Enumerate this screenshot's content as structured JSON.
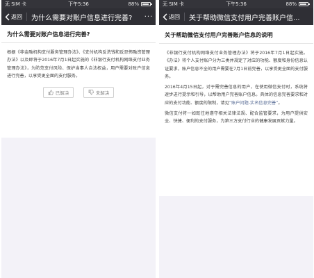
{
  "left": {
    "status": {
      "carrier": "无 SIM 卡",
      "time": "下午5:36",
      "battery": "88%",
      "battery_fraction": 0.88
    },
    "nav": {
      "back_label": "返回",
      "title": "为什么需要对账户信息进行完善?",
      "more": "···"
    },
    "title": "为什么需要对账户信息进行完善?",
    "paragraph": "根据《非金融机构支付服务管理办法》、《支付机构反洗钱和反恐怖融资管理办法》以及即将于2016年7月1日起实施的《非银行支付机构网络支付业务管理办法》，为防范支付风险、保护当事人合法权益，用户需要对账户信息进行完善，以享受更全面的支付服务。",
    "feedback": {
      "solved": "已解决",
      "unsolved": "未解决"
    }
  },
  "right": {
    "status": {
      "carrier": "无 SIM 卡",
      "time": "下午5:36",
      "battery": "88%",
      "battery_fraction": 0.88
    },
    "nav": {
      "back_label": "返回",
      "title": "关于帮助微信支付用户完善账户信..."
    },
    "title": "关于帮助微信支付用户完善账户信息的说明",
    "p1": "《非银行支付机构网络支付业务管理办法》将于2016年7月1日起实施。《办法》将个人支付账户分为三类并规定了对应的功能、额度和身份信息认证要求，账户信息不全的用户需要在7月1日前完善，以享受更全面的支付服务。",
    "p2_before": "2016年4月15日起，对于需完善信息的用户，在使用微信支付时，系统将逐步进行提示和引导，以帮助用户完善账户信息。具体的信息完善要求和对应的支付功能、额度的限制，请见",
    "p2_link": "“账户问题-实名信息完善”",
    "p2_after": "。",
    "p3": "微信支付将一如既往地遵守相关法律法规、配合监管要求，为用户提供安全、快捷、便利的支付服务，为第三方支付行业的健康发展贡献力量。"
  }
}
